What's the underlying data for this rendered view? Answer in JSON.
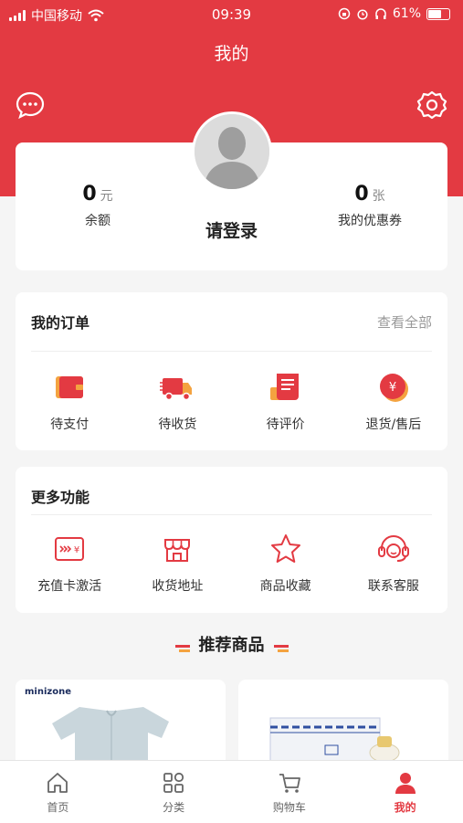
{
  "status_bar": {
    "carrier": "中国移动",
    "time": "09:39",
    "battery": "61%"
  },
  "header": {
    "title": "我的"
  },
  "profile": {
    "balance_value": "0",
    "balance_unit": "元",
    "balance_label": "余额",
    "login_text": "请登录",
    "coupon_value": "0",
    "coupon_unit": "张",
    "coupon_label": "我的优惠券"
  },
  "orders": {
    "title": "我的订单",
    "view_all": "查看全部",
    "items": [
      {
        "label": "待支付",
        "icon": "wallet-icon"
      },
      {
        "label": "待收货",
        "icon": "truck-icon"
      },
      {
        "label": "待评价",
        "icon": "review-icon"
      },
      {
        "label": "退货/售后",
        "icon": "refund-icon"
      }
    ]
  },
  "more": {
    "title": "更多功能",
    "items": [
      {
        "label": "充值卡激活",
        "icon": "card-icon"
      },
      {
        "label": "收货地址",
        "icon": "store-icon"
      },
      {
        "label": "商品收藏",
        "icon": "star-icon"
      },
      {
        "label": "联系客服",
        "icon": "headset-icon"
      }
    ]
  },
  "recommend": {
    "title": "推荐商品",
    "product1_brand": "minizone"
  },
  "tabbar": {
    "items": [
      {
        "label": "首页",
        "icon": "home-icon"
      },
      {
        "label": "分类",
        "icon": "category-icon"
      },
      {
        "label": "购物车",
        "icon": "cart-icon"
      },
      {
        "label": "我的",
        "icon": "user-icon"
      }
    ],
    "active_color": "#e33a42"
  },
  "colors": {
    "accent": "#e33a42",
    "secondary": "#f4a340"
  }
}
